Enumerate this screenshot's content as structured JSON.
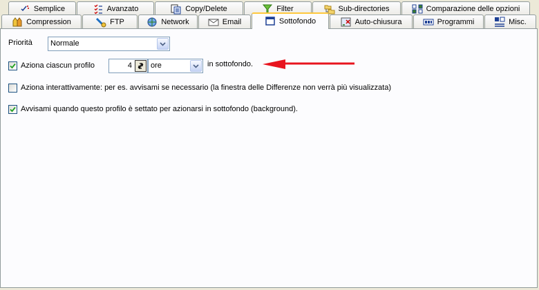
{
  "tabs_row1": [
    {
      "label": "Semplice",
      "icon": "check-dots-icon"
    },
    {
      "label": "Avanzato",
      "icon": "checklist-icon"
    },
    {
      "label": "Copy/Delete",
      "icon": "copy-delete-icon"
    },
    {
      "label": "Filter",
      "icon": "funnel-icon"
    },
    {
      "label": "Sub-directories",
      "icon": "folder-tree-icon"
    },
    {
      "label": "Comparazione delle opzioni",
      "icon": "compare-icon"
    }
  ],
  "tabs_row2": [
    {
      "label": "Compression",
      "icon": "compression-icon"
    },
    {
      "label": "FTP",
      "icon": "ftp-icon"
    },
    {
      "label": "Network",
      "icon": "network-icon"
    },
    {
      "label": "Email",
      "icon": "envelope-icon"
    },
    {
      "label": "Sottofondo",
      "icon": "window-icon",
      "active": true
    },
    {
      "label": "Auto-chiusura",
      "icon": "auto-close-icon"
    },
    {
      "label": "Programmi",
      "icon": "programs-icon"
    },
    {
      "label": "Misc.",
      "icon": "misc-icon"
    }
  ],
  "priority": {
    "label": "Priorità",
    "value": "Normale"
  },
  "run_each": {
    "label": "Aziona ciascun profilo",
    "checked": true,
    "amount": "4",
    "unit": "ore",
    "suffix": "in sottofondo."
  },
  "interactive": {
    "label": "Aziona interattivamente: per es. avvisami se necessario (la finestra delle Differenze non verrà più visualizzata)",
    "checked": false
  },
  "notify": {
    "label": "Avvisami quando questo profilo è settato per azionarsi in sottofondo (background).",
    "checked": true
  },
  "colors": {
    "arrow": "#e8141e",
    "active_tab_accent": "#ffc83c"
  }
}
